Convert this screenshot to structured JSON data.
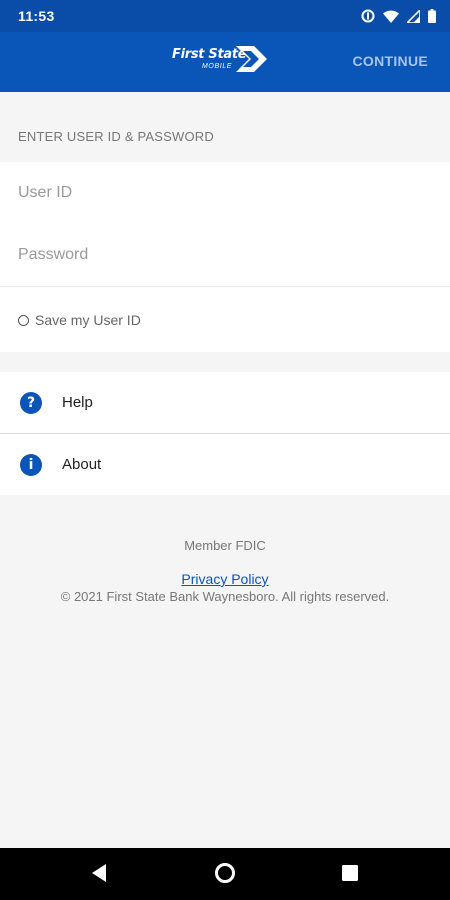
{
  "status_bar": {
    "time": "11:53",
    "icons": [
      "data-saver-icon",
      "wifi-icon",
      "signal-icon",
      "battery-icon"
    ]
  },
  "app_bar": {
    "logo_text": "First State",
    "logo_subtext": "MOBILE",
    "continue_label": "CONTINUE"
  },
  "login": {
    "section_header": "ENTER USER ID & PASSWORD",
    "user_id_placeholder": "User ID",
    "password_placeholder": "Password",
    "save_user_id_label": "Save my User ID"
  },
  "menu": {
    "items": [
      {
        "label": "Help",
        "icon": "help-icon",
        "glyph": "?"
      },
      {
        "label": "About",
        "icon": "info-icon",
        "glyph": "i"
      }
    ]
  },
  "footer": {
    "member_fdic": "Member FDIC",
    "privacy_policy": "Privacy Policy",
    "copyright": "© 2021 First State Bank Waynesboro. All rights reserved."
  },
  "nav": {
    "buttons": [
      "back-icon",
      "home-icon",
      "recents-icon"
    ]
  },
  "colors": {
    "brand_blue": "#0a55b8",
    "status_blue": "#0a4da8",
    "continue_text": "#a9c4ea",
    "background": "#f5f5f5"
  }
}
